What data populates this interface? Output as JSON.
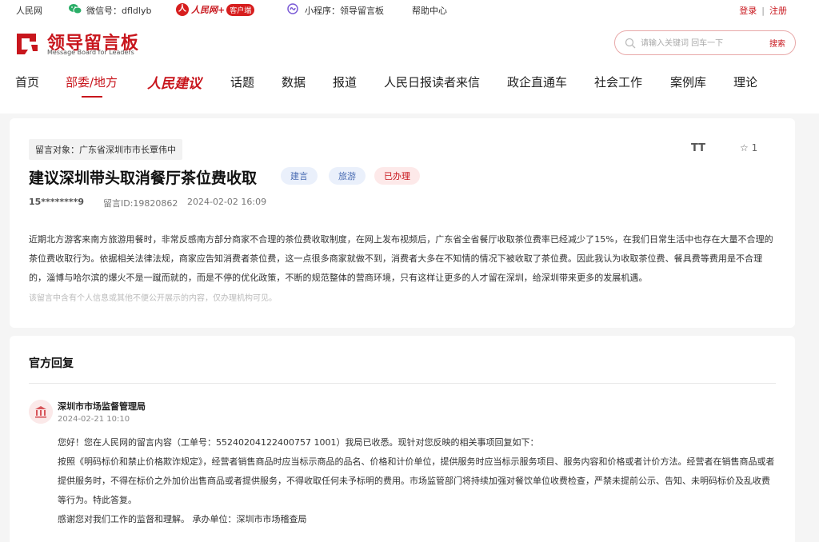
{
  "topbar": {
    "people_net": "人民网",
    "wechat": "微信号：dfldlyb",
    "rmw_logo_text": "人民网+",
    "rmw_badge": "客户端",
    "mini_program": "小程序：领导留言板",
    "help": "帮助中心",
    "login": "登录",
    "separator": "|",
    "register": "注册"
  },
  "header": {
    "logo_cn": "领导留言板",
    "logo_en": "Message Board for Leaders",
    "search_placeholder": "请输入关键词 回车一下",
    "search_button": "搜索"
  },
  "nav": {
    "items": [
      {
        "label": "首页"
      },
      {
        "label": "部委/地方"
      },
      {
        "label": "人民建议"
      },
      {
        "label": "话题"
      },
      {
        "label": "数据"
      },
      {
        "label": "报道"
      },
      {
        "label": "人民日报读者来信"
      },
      {
        "label": "政企直通车"
      },
      {
        "label": "社会工作"
      },
      {
        "label": "案例库"
      },
      {
        "label": "理论"
      }
    ],
    "active_index": 1
  },
  "message": {
    "target": "留言对象：广东省深圳市市长覃伟中",
    "font_toggle": "TT",
    "favorites_count": "1",
    "title": "建议深圳带头取消餐厅茶位费收取",
    "tags": [
      "建言",
      "旅游",
      "已办理"
    ],
    "user": "15********9",
    "message_id": "留言ID:19820862",
    "time": "2024-02-02 16:09",
    "body": "近期北方游客来南方旅游用餐时，非常反感南方部分商家不合理的茶位费收取制度，在网上发布视频后，广东省全省餐厅收取茶位费率已经减少了15%，在我们日常生活中也存在大量不合理的茶位费收取行为。依据相关法律法规，商家应告知消费者茶位费，这一点很多商家就做不到，消费者大多在不知情的情况下被收取了茶位费。因此我认为收取茶位费、餐具费等费用是不合理的，淄博与哈尔滨的爆火不是一蹴而就的，而是不停的优化政策，不断的规范整体的营商环境，只有这样让更多的人才留在深圳，给深圳带来更多的发展机遇。",
    "privacy_note": "该留言中含有个人信息或其他不便公开展示的内容，仅办理机构可见。"
  },
  "reply": {
    "heading": "官方回复",
    "department": "深圳市市场监督管理局",
    "time": "2024-02-21 10:10",
    "lines": [
      "您好！您在人民网的留言内容（工单号：55240204122400757 1001）我局已收悉。现针对您反映的相关事项回复如下：",
      "按照《明码标价和禁止价格欺诈规定》，经营者销售商品时应当标示商品的品名、价格和计价单位，提供服务时应当标示服务项目、服务内容和价格或者计价方法。经营者在销售商品或者提供服务时，不得在标价之外加价出售商品或者提供服务，不得收取任何未予标明的费用。市场监管部门将持续加强对餐饮单位收费检查，严禁未提前公示、告知、未明码标价及乱收费等行为。特此答复。",
      "感谢您对我们工作的监督和理解。 承办单位：深圳市市场稽查局"
    ]
  },
  "colors": {
    "brand_red": "#c8161d",
    "tag_blue_bg": "#eaf0fb",
    "tag_red_bg": "#fde9e9"
  }
}
